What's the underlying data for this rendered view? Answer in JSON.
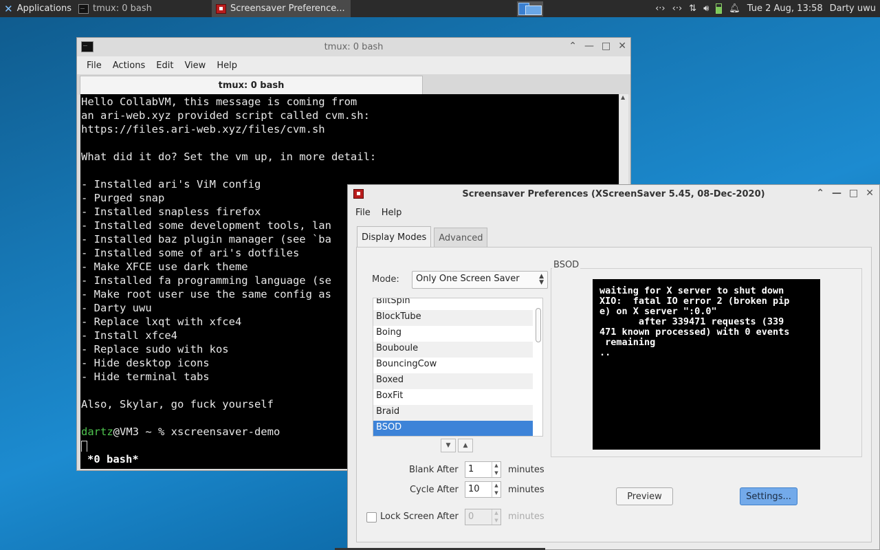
{
  "panel": {
    "applications_label": "Applications",
    "tasks": [
      {
        "label": "tmux: 0 bash"
      },
      {
        "label": "Screensaver Preference..."
      }
    ],
    "tray": {
      "clock": "Tue  2 Aug, 13:58",
      "user": "Darty uwu"
    }
  },
  "terminal": {
    "title": "tmux: 0 bash",
    "menu": [
      "File",
      "Actions",
      "Edit",
      "View",
      "Help"
    ],
    "tab_label": "tmux: 0 bash",
    "lines": [
      "Hello CollabVM, this message is coming from",
      "an ari-web.xyz provided script called cvm.sh:",
      "https://files.ari-web.xyz/files/cvm.sh",
      "",
      "What did it do? Set the vm up, in more detail:",
      "",
      "- Installed ari's ViM config",
      "- Purged snap",
      "- Installed snapless firefox",
      "- Installed some development tools, lan",
      "- Installed baz plugin manager (see `ba",
      "- Installed some of ari's dotfiles",
      "- Make XFCE use dark theme",
      "- Installed fa programming language (se",
      "- Make root user use the same config as",
      "- Darty uwu",
      "- Replace lxqt with xfce4",
      "- Install xfce4",
      "- Replace sudo with kos",
      "- Hide desktop icons",
      "- Hide terminal tabs",
      "",
      "Also, Skylar, go fuck yourself",
      ""
    ],
    "prompt_user": "dartz",
    "prompt_rest": "@VM3 ~ % xscreensaver-demo",
    "status_line": "*0 bash*"
  },
  "screensaver": {
    "title": "Screensaver Preferences  (XScreenSaver 5.45, 08-Dec-2020)",
    "menu": [
      "File",
      "Help"
    ],
    "tabs": [
      "Display Modes",
      "Advanced"
    ],
    "mode_label": "Mode:",
    "mode_value": "Only One Screen Saver",
    "list": [
      "BlitSpin",
      "BlockTube",
      "Boing",
      "Bouboule",
      "BouncingCow",
      "Boxed",
      "BoxFit",
      "Braid",
      "BSOD"
    ],
    "selected": "BSOD",
    "preview_title": "BSOD",
    "preview_text": "waiting for X server to shut down\nXIO:  fatal IO error 2 (broken pip\ne) on X server \":0.0\"\n       after 339471 requests (339\n471 known processed) with 0 events\n remaining\n..",
    "blank_after_label": "Blank After",
    "blank_after_value": "1",
    "cycle_after_label": "Cycle After",
    "cycle_after_value": "10",
    "lock_label": "Lock Screen After",
    "lock_value": "0",
    "minutes": "minutes",
    "preview_button": "Preview",
    "settings_button": "Settings..."
  }
}
